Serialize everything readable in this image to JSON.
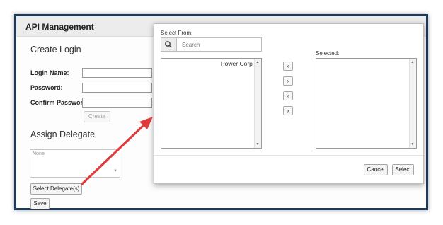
{
  "app": {
    "title": "API Management"
  },
  "create_login": {
    "heading": "Create Login",
    "login_name_label": "Login Name:",
    "password_label": "Password:",
    "confirm_password_label": "Confirm Password:",
    "login_name_value": "",
    "password_value": "",
    "confirm_password_value": "",
    "create_button": "Create"
  },
  "assign_delegate": {
    "heading": "Assign Delegate",
    "delegates_placeholder": "None",
    "select_delegates_button": "Select Delegate(s)",
    "save_button": "Save"
  },
  "modal": {
    "select_from_label": "Select From:",
    "search_placeholder": "Search",
    "search_icon": "magnifier-icon",
    "available_items": [
      "Power Corp"
    ],
    "selected_label": "Selected:",
    "selected_items": [],
    "move_all_right": "»",
    "move_right": "›",
    "move_left": "‹",
    "move_all_left": "«",
    "cancel_button": "Cancel",
    "select_button": "Select"
  },
  "colors": {
    "frame_border": "#1b3a5c",
    "annotation_arrow": "#e03b3b"
  }
}
